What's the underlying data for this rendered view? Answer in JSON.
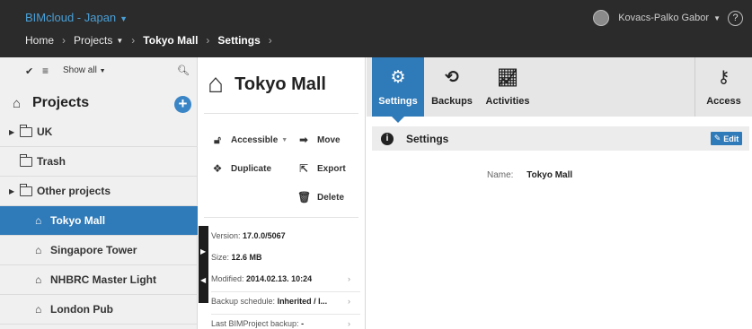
{
  "topbar": {
    "brand": "BIMcloud - Japan",
    "breadcrumb": [
      "Home",
      "Projects",
      "Tokyo Mall",
      "Settings"
    ],
    "user": "Kovacs-Palko Gabor",
    "help": "?"
  },
  "sidebar": {
    "filter_label": "Show all",
    "projects_header": "Projects",
    "items": [
      {
        "label": "UK"
      },
      {
        "label": "Trash"
      },
      {
        "label": "Other projects"
      },
      {
        "label": "Tokyo Mall"
      },
      {
        "label": "Singapore Tower"
      },
      {
        "label": "NHBRC Master Light"
      },
      {
        "label": "London Pub"
      }
    ]
  },
  "project": {
    "title": "Tokyo Mall",
    "actions": {
      "accessible": "Accessible",
      "move": "Move",
      "duplicate": "Duplicate",
      "export": "Export",
      "delete": "Delete"
    },
    "info": {
      "version_label": "Version:",
      "version_value": "17.0.0/5067",
      "size_label": "Size:",
      "size_value": "12.6 MB",
      "modified_label": "Modified:",
      "modified_value": "2014.02.13. 10:24",
      "backup_label": "Backup schedule:",
      "backup_value": "Inherited / I...",
      "last_label": "Last BIMProject backup:",
      "last_value": "-"
    }
  },
  "tabs": {
    "settings": "Settings",
    "backups": "Backups",
    "activities": "Activities",
    "access": "Access"
  },
  "settings_panel": {
    "title": "Settings",
    "edit": "Edit",
    "name_label": "Name:",
    "name_value": "Tokyo Mall"
  },
  "colors": {
    "accent": "#2f7ab8",
    "brand": "#4a9fd6",
    "topbar": "#2b2b2b"
  }
}
